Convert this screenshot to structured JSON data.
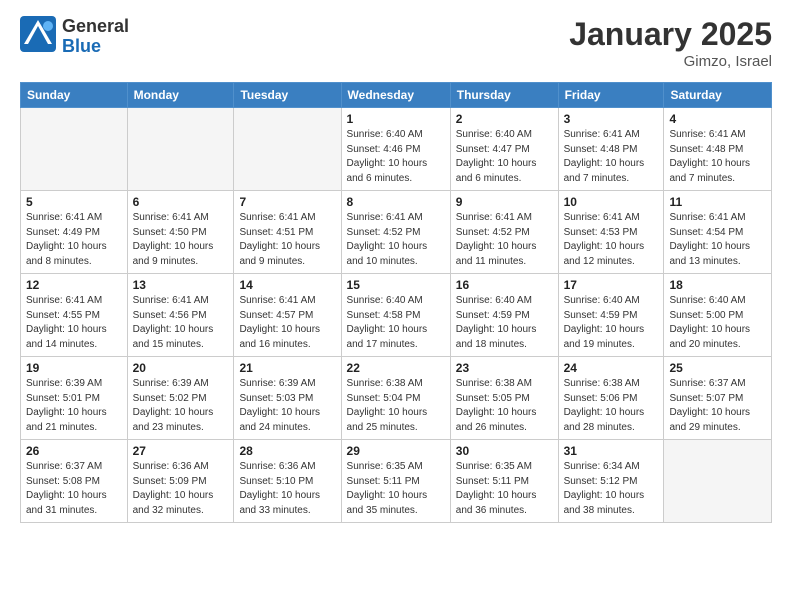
{
  "header": {
    "logo": {
      "general": "General",
      "blue": "Blue"
    },
    "title": "January 2025",
    "subtitle": "Gimzo, Israel"
  },
  "weekdays": [
    "Sunday",
    "Monday",
    "Tuesday",
    "Wednesday",
    "Thursday",
    "Friday",
    "Saturday"
  ],
  "weeks": [
    [
      {
        "day": "",
        "empty": true
      },
      {
        "day": "",
        "empty": true
      },
      {
        "day": "",
        "empty": true
      },
      {
        "day": "1",
        "sunrise": "6:40 AM",
        "sunset": "4:46 PM",
        "daylight": "10 hours and 6 minutes."
      },
      {
        "day": "2",
        "sunrise": "6:40 AM",
        "sunset": "4:47 PM",
        "daylight": "10 hours and 6 minutes."
      },
      {
        "day": "3",
        "sunrise": "6:41 AM",
        "sunset": "4:48 PM",
        "daylight": "10 hours and 7 minutes."
      },
      {
        "day": "4",
        "sunrise": "6:41 AM",
        "sunset": "4:48 PM",
        "daylight": "10 hours and 7 minutes."
      }
    ],
    [
      {
        "day": "5",
        "sunrise": "6:41 AM",
        "sunset": "4:49 PM",
        "daylight": "10 hours and 8 minutes."
      },
      {
        "day": "6",
        "sunrise": "6:41 AM",
        "sunset": "4:50 PM",
        "daylight": "10 hours and 9 minutes."
      },
      {
        "day": "7",
        "sunrise": "6:41 AM",
        "sunset": "4:51 PM",
        "daylight": "10 hours and 9 minutes."
      },
      {
        "day": "8",
        "sunrise": "6:41 AM",
        "sunset": "4:52 PM",
        "daylight": "10 hours and 10 minutes."
      },
      {
        "day": "9",
        "sunrise": "6:41 AM",
        "sunset": "4:52 PM",
        "daylight": "10 hours and 11 minutes."
      },
      {
        "day": "10",
        "sunrise": "6:41 AM",
        "sunset": "4:53 PM",
        "daylight": "10 hours and 12 minutes."
      },
      {
        "day": "11",
        "sunrise": "6:41 AM",
        "sunset": "4:54 PM",
        "daylight": "10 hours and 13 minutes."
      }
    ],
    [
      {
        "day": "12",
        "sunrise": "6:41 AM",
        "sunset": "4:55 PM",
        "daylight": "10 hours and 14 minutes."
      },
      {
        "day": "13",
        "sunrise": "6:41 AM",
        "sunset": "4:56 PM",
        "daylight": "10 hours and 15 minutes."
      },
      {
        "day": "14",
        "sunrise": "6:41 AM",
        "sunset": "4:57 PM",
        "daylight": "10 hours and 16 minutes."
      },
      {
        "day": "15",
        "sunrise": "6:40 AM",
        "sunset": "4:58 PM",
        "daylight": "10 hours and 17 minutes."
      },
      {
        "day": "16",
        "sunrise": "6:40 AM",
        "sunset": "4:59 PM",
        "daylight": "10 hours and 18 minutes."
      },
      {
        "day": "17",
        "sunrise": "6:40 AM",
        "sunset": "4:59 PM",
        "daylight": "10 hours and 19 minutes."
      },
      {
        "day": "18",
        "sunrise": "6:40 AM",
        "sunset": "5:00 PM",
        "daylight": "10 hours and 20 minutes."
      }
    ],
    [
      {
        "day": "19",
        "sunrise": "6:39 AM",
        "sunset": "5:01 PM",
        "daylight": "10 hours and 21 minutes."
      },
      {
        "day": "20",
        "sunrise": "6:39 AM",
        "sunset": "5:02 PM",
        "daylight": "10 hours and 23 minutes."
      },
      {
        "day": "21",
        "sunrise": "6:39 AM",
        "sunset": "5:03 PM",
        "daylight": "10 hours and 24 minutes."
      },
      {
        "day": "22",
        "sunrise": "6:38 AM",
        "sunset": "5:04 PM",
        "daylight": "10 hours and 25 minutes."
      },
      {
        "day": "23",
        "sunrise": "6:38 AM",
        "sunset": "5:05 PM",
        "daylight": "10 hours and 26 minutes."
      },
      {
        "day": "24",
        "sunrise": "6:38 AM",
        "sunset": "5:06 PM",
        "daylight": "10 hours and 28 minutes."
      },
      {
        "day": "25",
        "sunrise": "6:37 AM",
        "sunset": "5:07 PM",
        "daylight": "10 hours and 29 minutes."
      }
    ],
    [
      {
        "day": "26",
        "sunrise": "6:37 AM",
        "sunset": "5:08 PM",
        "daylight": "10 hours and 31 minutes."
      },
      {
        "day": "27",
        "sunrise": "6:36 AM",
        "sunset": "5:09 PM",
        "daylight": "10 hours and 32 minutes."
      },
      {
        "day": "28",
        "sunrise": "6:36 AM",
        "sunset": "5:10 PM",
        "daylight": "10 hours and 33 minutes."
      },
      {
        "day": "29",
        "sunrise": "6:35 AM",
        "sunset": "5:11 PM",
        "daylight": "10 hours and 35 minutes."
      },
      {
        "day": "30",
        "sunrise": "6:35 AM",
        "sunset": "5:11 PM",
        "daylight": "10 hours and 36 minutes."
      },
      {
        "day": "31",
        "sunrise": "6:34 AM",
        "sunset": "5:12 PM",
        "daylight": "10 hours and 38 minutes."
      },
      {
        "day": "",
        "empty": true
      }
    ]
  ],
  "labels": {
    "sunrise": "Sunrise:",
    "sunset": "Sunset:",
    "daylight": "Daylight:"
  }
}
